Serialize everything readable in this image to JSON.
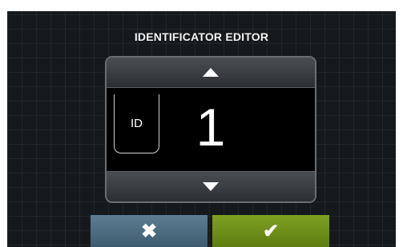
{
  "screen": {
    "title": "IDENTIFICATOR EDITOR"
  },
  "editor": {
    "field_label": "ID",
    "value": "1",
    "up_icon": "up-triangle",
    "down_icon": "down-triangle"
  },
  "actions": {
    "cancel_glyph": "✖",
    "cancel_icon": "close-icon",
    "confirm_glyph": "✔",
    "confirm_icon": "check-icon"
  },
  "colors": {
    "background": "#16191c",
    "cancel_button": "#4e6f84",
    "confirm_button": "#739419"
  }
}
